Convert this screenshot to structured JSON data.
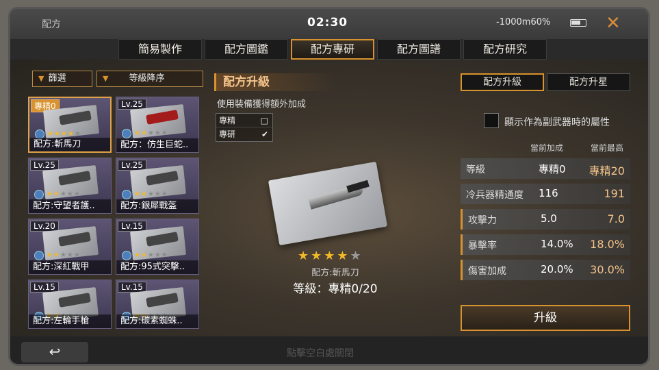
{
  "topbar": {
    "title": "配方",
    "clock": "02:30",
    "status": "-1000m60%"
  },
  "tabs": [
    "簡易製作",
    "配方圖鑑",
    "配方專研",
    "配方圖譜",
    "配方研究"
  ],
  "filters": {
    "filter_label": "篩選",
    "sort_label": "等級降序"
  },
  "cards": [
    {
      "level": "專精0",
      "name": "配方:斬馬刀",
      "stars": 4
    },
    {
      "level": "Lv.25",
      "name": "配方：仿生巨蛇..",
      "stars": 2
    },
    {
      "level": "Lv.25",
      "name": "配方:守望者護..",
      "stars": 2
    },
    {
      "level": "Lv.25",
      "name": "配方:銀犀戰盔",
      "stars": 2
    },
    {
      "level": "Lv.20",
      "name": "配方:深紅戰甲",
      "stars": 2
    },
    {
      "level": "Lv.15",
      "name": "配方:95式突擊..",
      "stars": 2
    },
    {
      "level": "Lv.15",
      "name": "配方:左輪手槍",
      "stars": 2
    },
    {
      "level": "Lv.15",
      "name": "配方:碳素蜘蛛..",
      "stars": 2
    }
  ],
  "middle": {
    "title": "配方升級",
    "subtitle": "使用裝備獲得額外加成",
    "options": [
      {
        "label": "專精",
        "checked": false
      },
      {
        "label": "專研",
        "checked": true
      }
    ],
    "item_name": "配方:斬馬刀",
    "level_text": "等級：專精0/20",
    "stars": 4
  },
  "right": {
    "tabs": [
      "配方升級",
      "配方升星"
    ],
    "toggle_label": "顯示作為副武器時的屬性",
    "col_current": "當前加成",
    "col_max": "當前最高",
    "stats": [
      {
        "label": "等級",
        "current": "專精0",
        "max": "專精20"
      },
      {
        "label": "冷兵器精通度",
        "current": "116",
        "max": "191"
      },
      {
        "label": "攻擊力",
        "current": "5.0",
        "max": "7.0"
      },
      {
        "label": "暴擊率",
        "current": "14.0%",
        "max": "18.0%"
      },
      {
        "label": "傷害加成",
        "current": "20.0%",
        "max": "30.0%"
      }
    ],
    "upgrade_label": "升級"
  },
  "bottom": {
    "back_icon": "↩",
    "hint": "點擊空白處關閉"
  }
}
